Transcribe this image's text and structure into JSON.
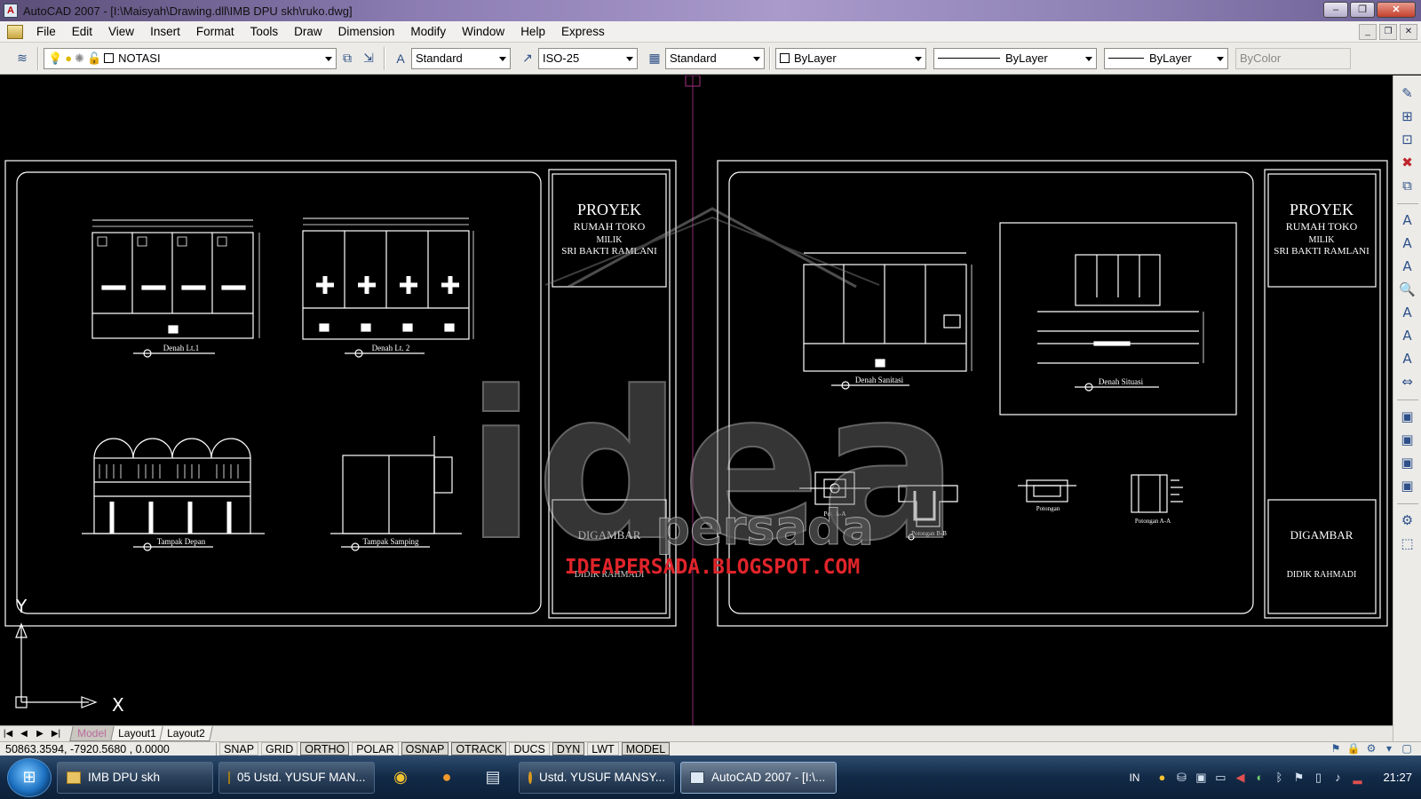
{
  "window": {
    "title": "AutoCAD 2007 - [I:\\Maisyah\\Drawing.dll\\IMB DPU skh\\ruko.dwg]",
    "controls": [
      "–",
      "❐",
      "✕"
    ]
  },
  "menu": [
    "File",
    "Edit",
    "View",
    "Insert",
    "Format",
    "Tools",
    "Draw",
    "Dimension",
    "Modify",
    "Window",
    "Help",
    "Express"
  ],
  "toolbar": {
    "layer": "NOTASI",
    "text_style": "Standard",
    "dim_style": "ISO-25",
    "table_style": "Standard",
    "color": "ByLayer",
    "linetype": "ByLayer",
    "lineweight": "ByLayer",
    "plot_style": "ByColor"
  },
  "drawing": {
    "sheet1": {
      "title_block": {
        "project": "PROYEK",
        "subtitle1": "RUMAH TOKO",
        "subtitle2": "MILIK",
        "owner": "SRI BAKTI RAMLANI",
        "drawn_label": "DIGAMBAR",
        "drawn_by": "DIDIK RAHMADI"
      },
      "labels": [
        "Denah Lt.1",
        "Denah Lt. 2",
        "Tampak Depan",
        "Tampak Samping"
      ]
    },
    "sheet2": {
      "title_block": {
        "project": "PROYEK",
        "subtitle1": "RUMAH TOKO",
        "subtitle2": "MILIK",
        "owner": "SRI BAKTI RAMLANI",
        "drawn_label": "DIGAMBAR",
        "drawn_by": "DIDIK RAHMADI"
      },
      "labels": [
        "Denah Sanitasi",
        "Denah Situasi",
        "Pot. A-A",
        "Potongan B-B",
        "Potongan",
        "Potongan A-A"
      ]
    },
    "watermark": {
      "brand": "idea",
      "sub": "persada",
      "url": "IDEAPERSADA.BLOGSPOT.COM"
    },
    "ucs": {
      "x": "X",
      "y": "Y"
    }
  },
  "tabs": [
    "Model",
    "Layout1",
    "Layout2"
  ],
  "tab_nav": [
    "|◀",
    "◀",
    "▶",
    "▶|"
  ],
  "status": {
    "coords": "50863.3594, -7920.5680 , 0.0000",
    "buttons": [
      "SNAP",
      "GRID",
      "ORTHO",
      "POLAR",
      "OSNAP",
      "OTRACK",
      "DUCS",
      "DYN",
      "LWT",
      "MODEL"
    ]
  },
  "taskbar": {
    "start_icon": "windows-logo",
    "tasks": [
      "IMB DPU skh",
      "05 Ustd. YUSUF MAN...",
      "Ustd. YUSUF MANSY...",
      "AutoCAD 2007 - [I:\\..."
    ],
    "language": "IN",
    "clock": "21:27"
  },
  "colors": {
    "canvas": "#000000",
    "watermark_red": "#e0242a",
    "ui_face": "#ecebe7"
  }
}
